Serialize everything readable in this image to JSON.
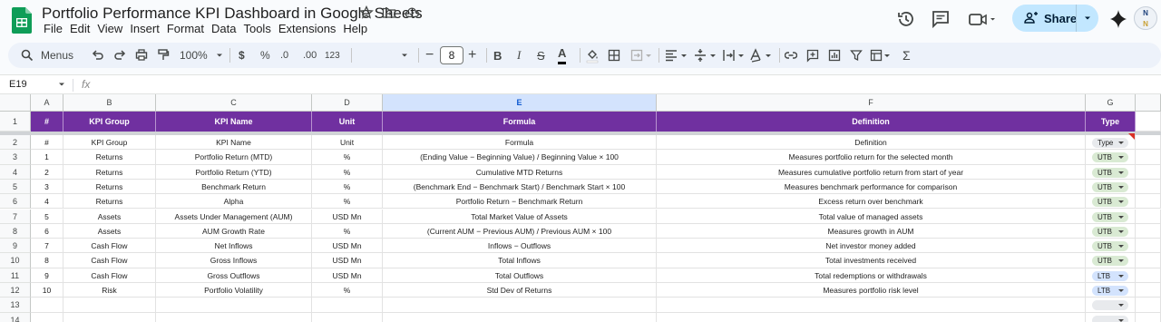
{
  "doc": {
    "title": "Portfolio Performance KPI Dashboard in Google Sheets"
  },
  "menu": [
    "File",
    "Edit",
    "View",
    "Insert",
    "Format",
    "Data",
    "Tools",
    "Extensions",
    "Help"
  ],
  "share": {
    "label": "Share"
  },
  "avatar": {
    "initials": "N"
  },
  "toolbar": {
    "menus_label": "Menus",
    "zoom": "100%",
    "currency": "$",
    "percent": "%",
    "dec_decrease": ".0",
    "dec_increase": ".00",
    "number_format": "123",
    "font_size": "8"
  },
  "formula_bar": {
    "cell_ref": "E19",
    "fx": "fx",
    "value": ""
  },
  "columns": [
    "A",
    "B",
    "C",
    "D",
    "E",
    "F",
    "G"
  ],
  "selected_column": "E",
  "header_row": [
    "#",
    "KPI Group",
    "KPI Name",
    "Unit",
    "Formula",
    "Definition",
    "Type"
  ],
  "rows": [
    {
      "num": "#",
      "group": "KPI Group",
      "name": "KPI Name",
      "unit": "Unit",
      "formula": "Formula",
      "definition": "Definition",
      "type": "Type"
    },
    {
      "num": "1",
      "group": "Returns",
      "name": "Portfolio Return (MTD)",
      "unit": "%",
      "formula": "(Ending Value − Beginning Value) / Beginning Value × 100",
      "definition": "Measures portfolio return for the selected month",
      "type": "UTB"
    },
    {
      "num": "2",
      "group": "Returns",
      "name": "Portfolio Return (YTD)",
      "unit": "%",
      "formula": "Cumulative MTD Returns",
      "definition": "Measures cumulative portfolio return from start of year",
      "type": "UTB"
    },
    {
      "num": "3",
      "group": "Returns",
      "name": "Benchmark Return",
      "unit": "%",
      "formula": "(Benchmark End − Benchmark Start) / Benchmark Start × 100",
      "definition": "Measures benchmark performance for comparison",
      "type": "UTB"
    },
    {
      "num": "4",
      "group": "Returns",
      "name": "Alpha",
      "unit": "%",
      "formula": "Portfolio Return − Benchmark Return",
      "definition": "Excess return over benchmark",
      "type": "UTB"
    },
    {
      "num": "5",
      "group": "Assets",
      "name": "Assets Under Management (AUM)",
      "unit": "USD Mn",
      "formula": "Total Market Value of Assets",
      "definition": "Total value of managed assets",
      "type": "UTB"
    },
    {
      "num": "6",
      "group": "Assets",
      "name": "AUM Growth Rate",
      "unit": "%",
      "formula": "(Current AUM − Previous AUM) / Previous AUM × 100",
      "definition": "Measures growth in AUM",
      "type": "UTB"
    },
    {
      "num": "7",
      "group": "Cash Flow",
      "name": "Net Inflows",
      "unit": "USD Mn",
      "formula": "Inflows − Outflows",
      "definition": "Net investor money added",
      "type": "UTB"
    },
    {
      "num": "8",
      "group": "Cash Flow",
      "name": "Gross Inflows",
      "unit": "USD Mn",
      "formula": "Total Inflows",
      "definition": "Total investments received",
      "type": "UTB"
    },
    {
      "num": "9",
      "group": "Cash Flow",
      "name": "Gross Outflows",
      "unit": "USD Mn",
      "formula": "Total Outflows",
      "definition": "Total redemptions or withdrawals",
      "type": "LTB"
    },
    {
      "num": "10",
      "group": "Risk",
      "name": "Portfolio Volatility",
      "unit": "%",
      "formula": "Std Dev of Returns",
      "definition": "Measures portfolio risk level",
      "type": "LTB"
    },
    {
      "num": "",
      "group": "",
      "name": "",
      "unit": "",
      "formula": "",
      "definition": "",
      "type": ""
    },
    {
      "num": "",
      "group": "",
      "name": "",
      "unit": "",
      "formula": "",
      "definition": "",
      "type": ""
    }
  ],
  "colors": {
    "header_bg": "#7030a0",
    "utb_chip": "#d9ead3",
    "ltb_chip": "#d3e3fd",
    "type_chip": "#e8eaed",
    "share_bg": "#c2e7ff",
    "logo": "#0f9d58"
  }
}
